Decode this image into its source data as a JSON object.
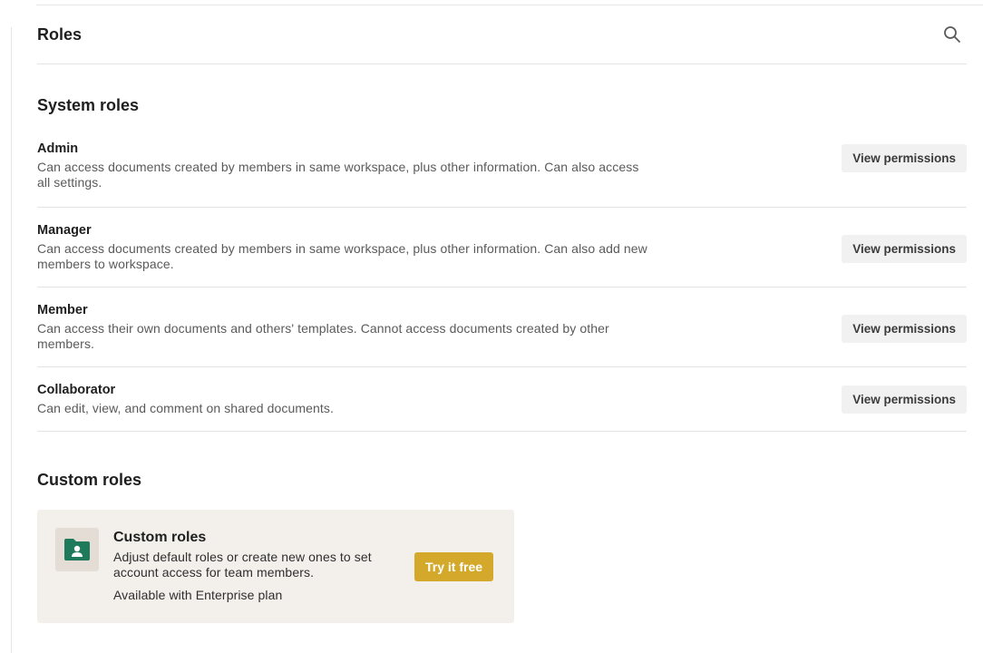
{
  "header": {
    "title": "Roles"
  },
  "system_roles": {
    "title": "System roles",
    "items": [
      {
        "name": "Admin",
        "description": "Can access documents created by members in same workspace, plus other information. Can also access all settings.",
        "button_label": "View permissions"
      },
      {
        "name": "Manager",
        "description": "Can access documents created by members in same workspace, plus other information. Can also add new members to workspace.",
        "button_label": "View permissions"
      },
      {
        "name": "Member",
        "description": "Can access their own documents and others' templates. Cannot access documents created by other members.",
        "button_label": "View permissions"
      },
      {
        "name": "Collaborator",
        "description": "Can edit, view, and comment on shared documents.",
        "button_label": "View permissions"
      }
    ]
  },
  "custom_roles": {
    "title": "Custom roles",
    "promo": {
      "title": "Custom roles",
      "description": "Adjust default roles or create new ones to set account access for team members.",
      "plan_note": "Available with Enterprise plan",
      "button_label": "Try it free",
      "icon": "folder-user-icon"
    }
  },
  "colors": {
    "accent_button": "#d4a82a",
    "icon_green": "#1f7a5c",
    "card_background": "#f3efeb"
  }
}
